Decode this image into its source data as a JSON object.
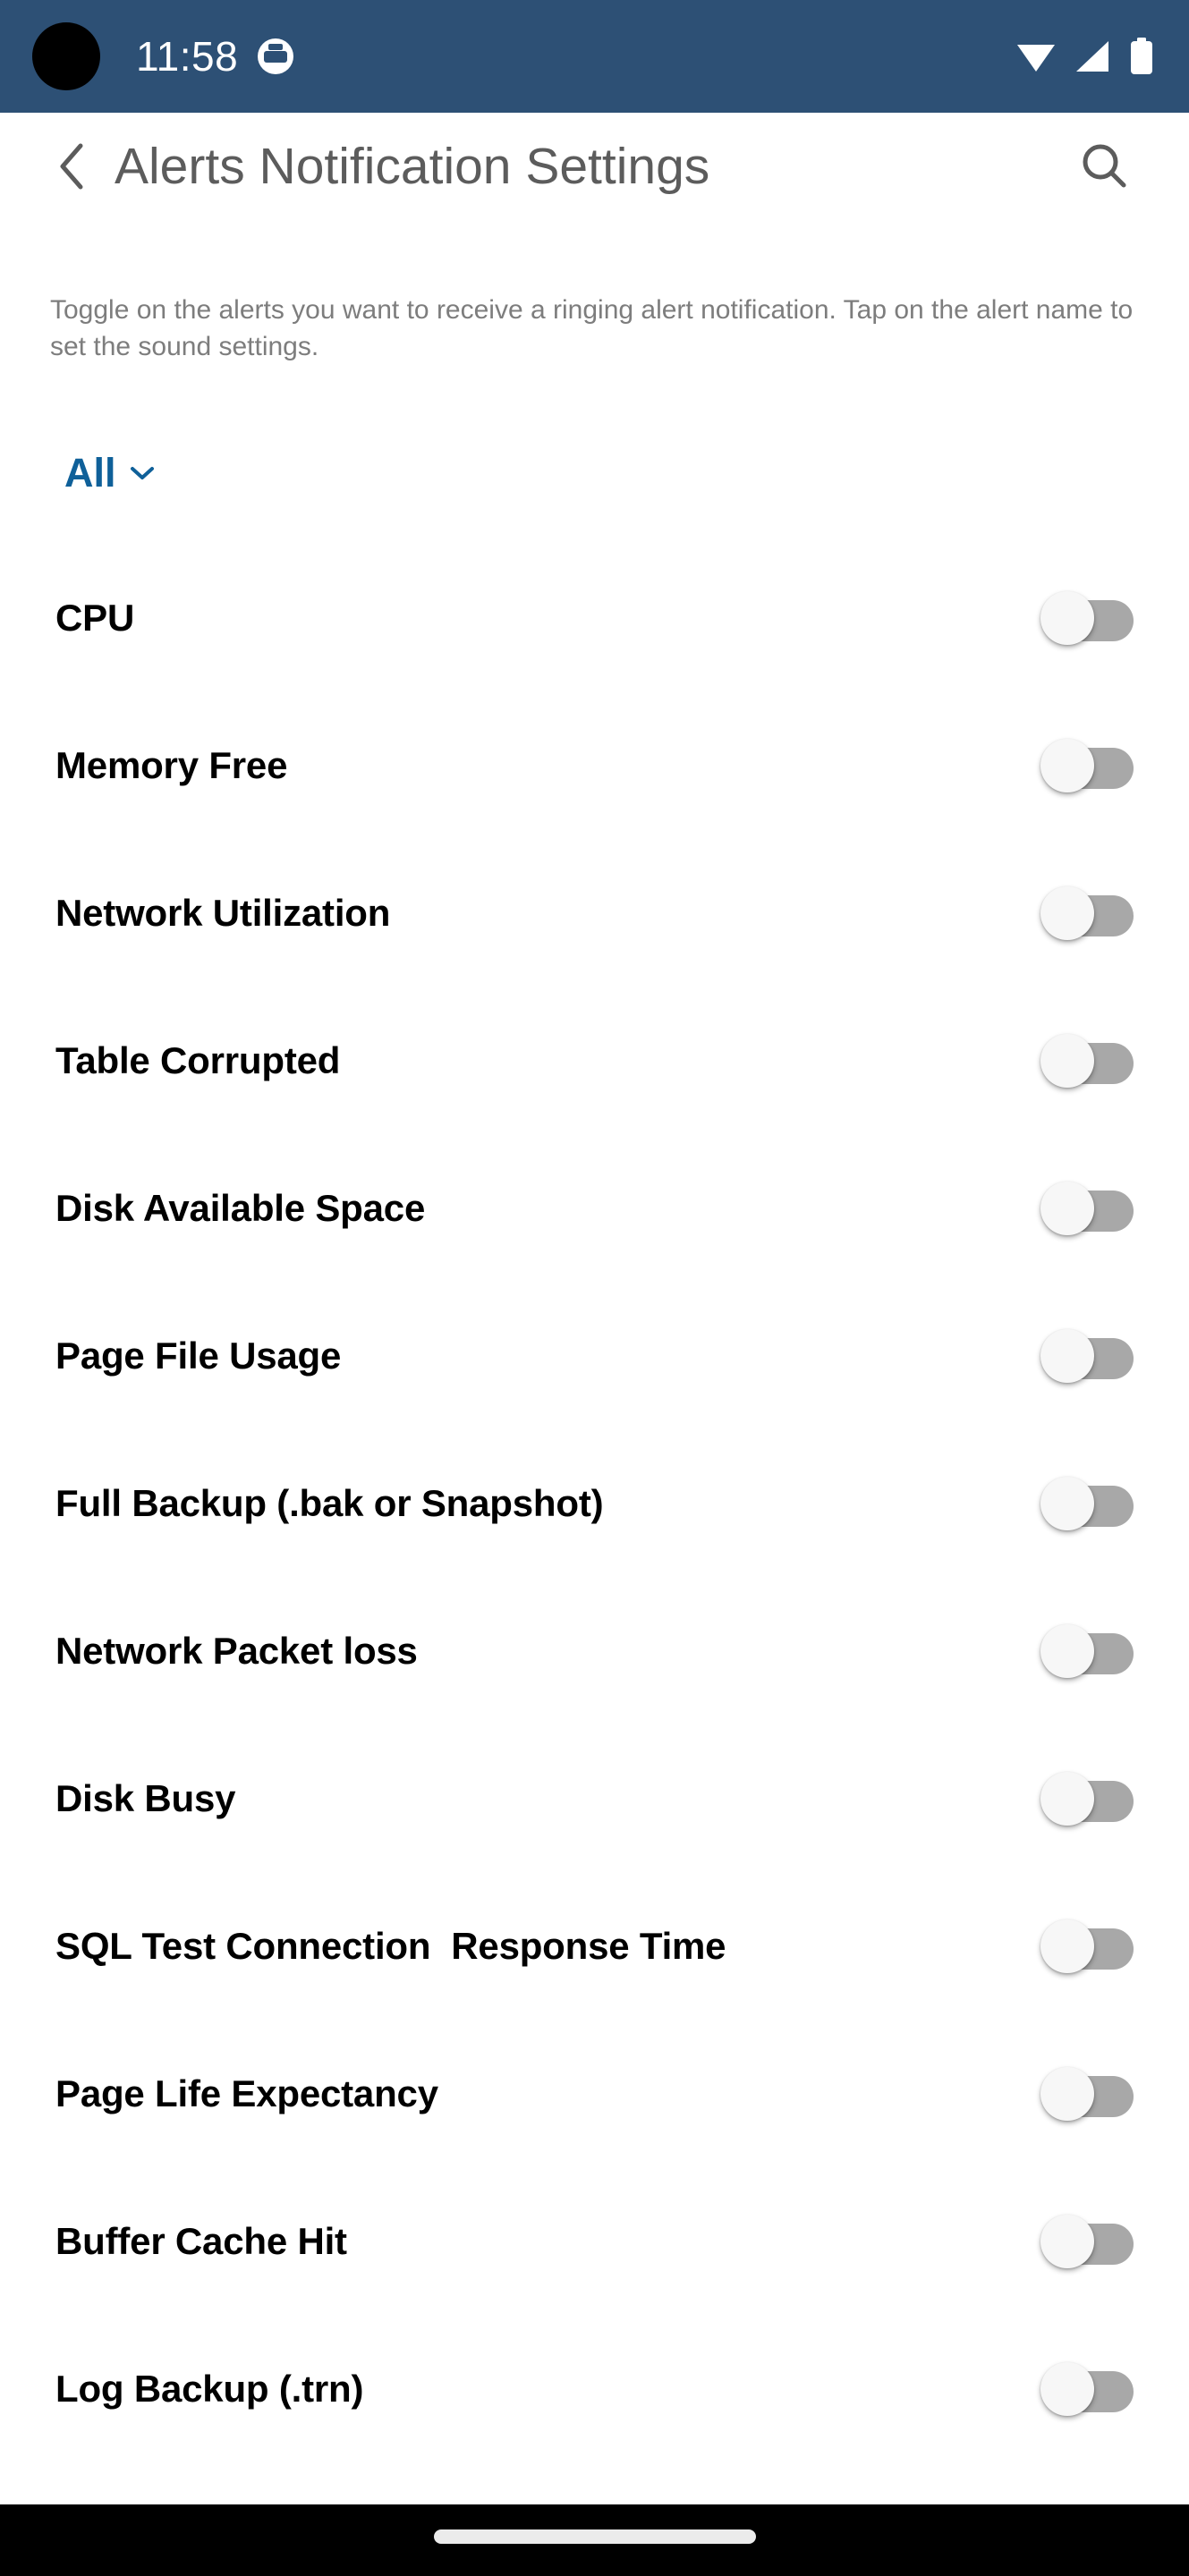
{
  "status_bar": {
    "time": "11:58",
    "background_color": "#2d5075",
    "notification_icon": "notification-badge-icon",
    "wifi_icon": "wifi-icon",
    "signal_icon": "cellular-signal-icon",
    "battery_icon": "battery-full-icon"
  },
  "header": {
    "back_icon": "chevron-left-icon",
    "title": "Alerts Notification Settings",
    "search_icon": "search-icon",
    "title_color": "#5c5c5c"
  },
  "description": "Toggle on the alerts you want to receive a ringing alert notification. Tap on the alert name to set the sound settings.",
  "filter": {
    "label": "All",
    "chevron_icon": "chevron-down-icon",
    "color": "#0f6099"
  },
  "alerts": [
    {
      "label": "CPU",
      "enabled": false
    },
    {
      "label": "Memory Free",
      "enabled": false
    },
    {
      "label": "Network Utilization",
      "enabled": false
    },
    {
      "label": "Table Corrupted",
      "enabled": false
    },
    {
      "label": "Disk Available Space",
      "enabled": false
    },
    {
      "label": "Page File Usage",
      "enabled": false
    },
    {
      "label": "Full Backup (.bak or Snapshot)",
      "enabled": false
    },
    {
      "label": "Network Packet loss",
      "enabled": false
    },
    {
      "label": "Disk Busy",
      "enabled": false
    },
    {
      "label": "SQL Test Connection  Response Time",
      "enabled": false
    },
    {
      "label": "Page Life Expectancy",
      "enabled": false
    },
    {
      "label": "Buffer Cache Hit",
      "enabled": false
    },
    {
      "label": "Log Backup (.trn)",
      "enabled": false
    }
  ],
  "nav_bar": {
    "gesture_pill": "home-gesture-pill",
    "background_color": "#000000"
  }
}
